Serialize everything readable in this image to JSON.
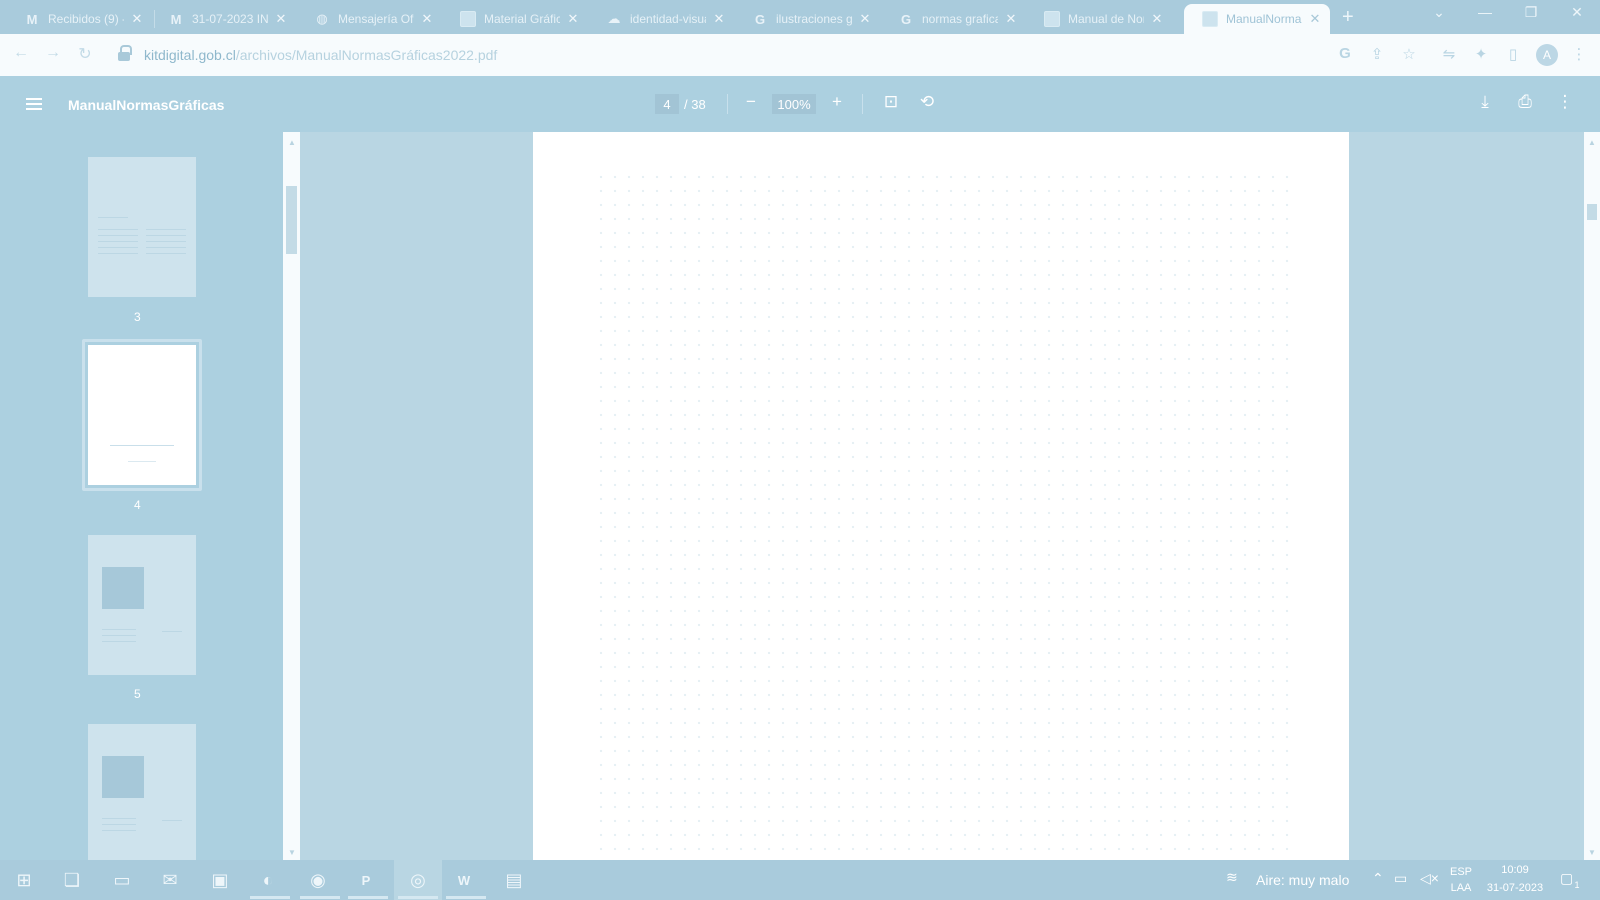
{
  "browser": {
    "tabs": [
      {
        "title": "Recibidos (9) - a",
        "icon": "gmail-icon",
        "glyph": "M"
      },
      {
        "title": "31-07-2023 INF",
        "icon": "gmail-icon",
        "glyph": "M"
      },
      {
        "title": "Mensajería Ofic",
        "icon": "globe-icon",
        "glyph": "◍"
      },
      {
        "title": "Material Gráfic",
        "icon": "doc-icon",
        "glyph": ""
      },
      {
        "title": "identidad-visua",
        "icon": "cloud-icon",
        "glyph": "☁"
      },
      {
        "title": "ilustraciones go",
        "icon": "google-icon",
        "glyph": "G"
      },
      {
        "title": "normas grafica",
        "icon": "google-icon",
        "glyph": "G"
      },
      {
        "title": "Manual de Nor",
        "icon": "doc-icon",
        "glyph": ""
      },
      {
        "title": "ManualNorma",
        "icon": "doc-icon",
        "glyph": ""
      }
    ],
    "close_glyph": "✕",
    "new_tab_glyph": "+",
    "url_host": "kitdigital.gob.cl",
    "url_path": "/archivos/ManualNormasGráficas2022.pdf",
    "avatar_letter": "A"
  },
  "pdf_viewer": {
    "title": "ManualNormasGráficas",
    "current_page": "4",
    "total_pages": "/ 38",
    "zoom": "100%",
    "thumbnails": [
      {
        "label": "3"
      },
      {
        "label": "4"
      },
      {
        "label": "5"
      },
      {
        "label": ""
      }
    ]
  },
  "taskbar": {
    "air_quality": "Aire: muy malo",
    "language": "ESP",
    "layout": "LAA",
    "time": "10:09",
    "date": "31-07-2023",
    "notifications": "1"
  }
}
